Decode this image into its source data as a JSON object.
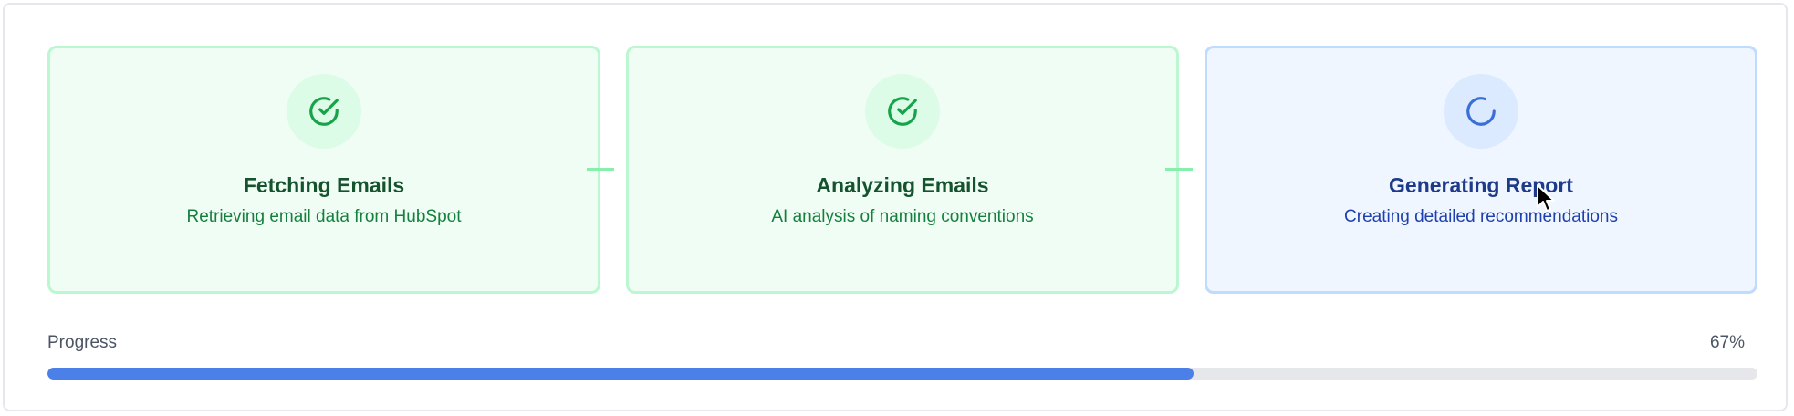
{
  "steps": [
    {
      "title": "Fetching Emails",
      "description": "Retrieving email data from HubSpot",
      "status": "complete",
      "icon": "check-circle-icon"
    },
    {
      "title": "Analyzing Emails",
      "description": "AI analysis of naming conventions",
      "status": "complete",
      "icon": "check-circle-icon"
    },
    {
      "title": "Generating Report",
      "description": "Creating detailed recommendations",
      "status": "in-progress",
      "icon": "spinner-icon"
    }
  ],
  "progress": {
    "label": "Progress",
    "value_text": "67%",
    "fraction": 0.67
  },
  "colors": {
    "complete_bg": "#f0fdf4",
    "complete_border": "#bbf7d0",
    "complete_icon": "#16a34a",
    "active_bg": "#eff6ff",
    "active_border": "#bfdbfe",
    "active_icon": "#3b6fd8",
    "progress_fill": "#4a80e8",
    "progress_track": "#e5e7eb"
  }
}
